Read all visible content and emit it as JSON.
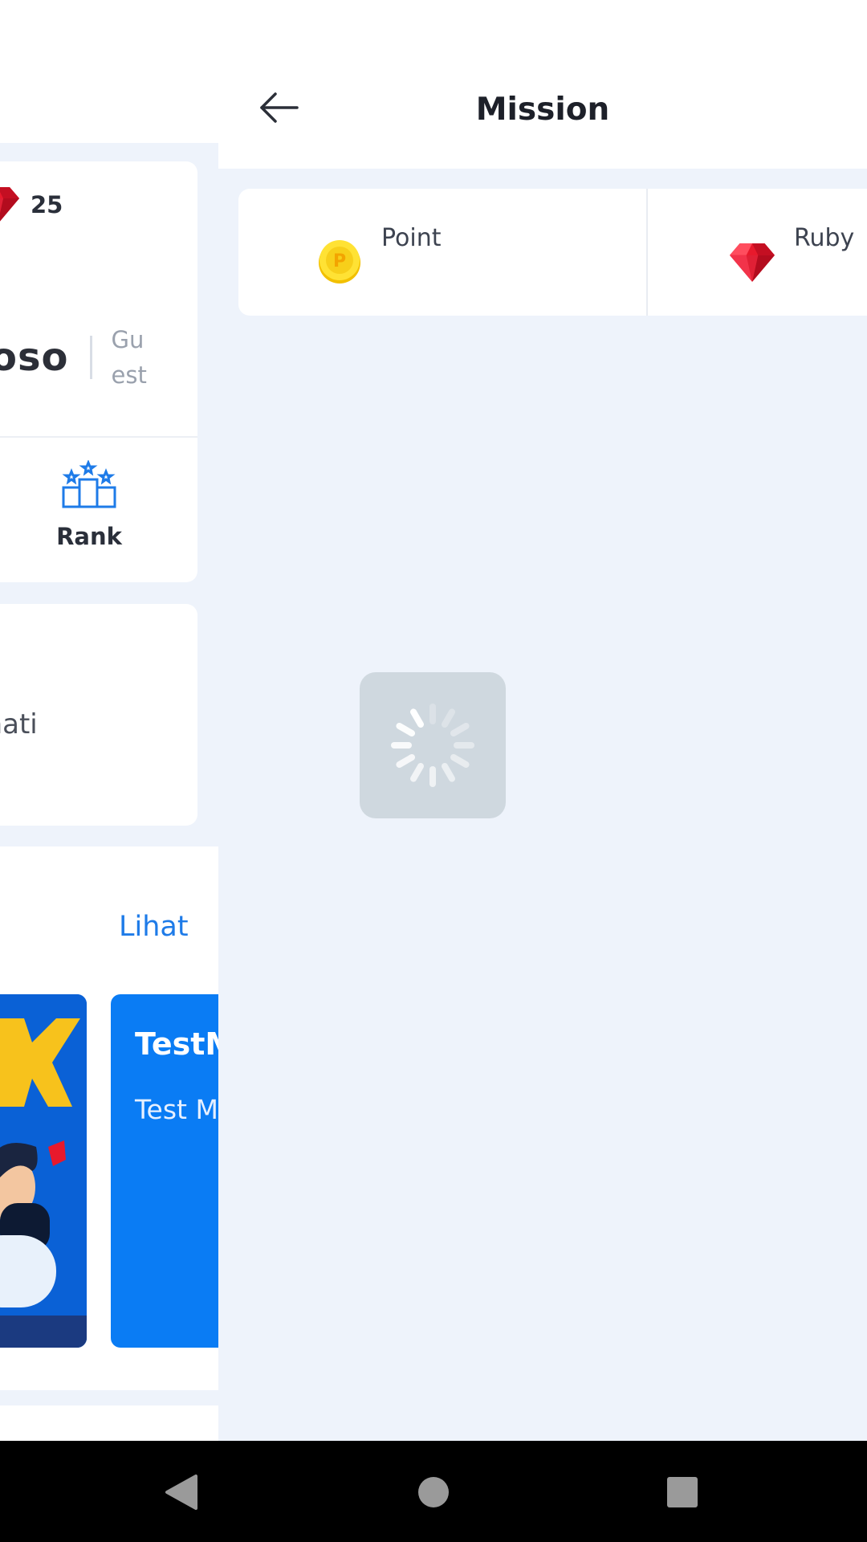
{
  "background_page": {
    "ruby_count": "25",
    "user_name": "oso",
    "user_role": "Guest",
    "rank_label": "Rank",
    "info_text": "mati",
    "see_all_label": "Lihat",
    "banner_title": "TestM",
    "banner_desc": "Test M"
  },
  "header": {
    "title": "Mission",
    "back_icon": "arrow-left-icon"
  },
  "tabs": [
    {
      "label": "Point",
      "icon": "coin-icon"
    },
    {
      "label": "Ruby",
      "icon": "ruby-gem-icon"
    }
  ],
  "loading": {
    "icon": "spinner-icon"
  },
  "nav_bar": {
    "back_icon": "triangle-back-icon",
    "home_icon": "circle-home-icon",
    "recents_icon": "square-recents-icon"
  },
  "colors": {
    "accent": "#1e7be8",
    "page_background": "#eef3fb",
    "ruby_red": "#e8192c",
    "coin_yellow": "#f7d21c",
    "loader_bg": "#cfd8df"
  }
}
